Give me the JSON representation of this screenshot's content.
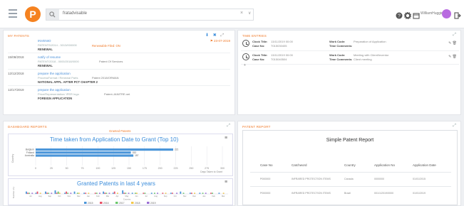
{
  "topbar": {
    "logo_letter": "P",
    "search_value": "fratadvisable",
    "clear_glyph": "×",
    "dropdown_glyph": "∨",
    "user_name": "WilliamHuggin",
    "icons": [
      "menu-icon",
      "search-icon",
      "help-icon",
      "settings-icon",
      "calendar-icon",
      "logout-icon"
    ]
  },
  "panel_patents": {
    "title": "MY PATENTS",
    "tools": [
      "⬇",
      "✖",
      "⤢"
    ],
    "rows": [
      {
        "date": "",
        "title": "INVENIO",
        "sub": "PATENTS/2014 - 3013/000000",
        "tag": "RENEWAL",
        "orange": "Renewable Filed: ON",
        "flag": "⚑ 23-07-2019"
      },
      {
        "date": "15/08/2018",
        "title": "notify of resume",
        "sub": "PATENT/2018 - 0000/2018/0000",
        "sub2": "Patent Of Services",
        "tag": "RENEWAL"
      },
      {
        "date": "12/12/2018",
        "title": "prepare the application",
        "sub": "ProcessFormat / Renewal Parts",
        "sub2": "Patent 2018/ORMAN",
        "tag": "NATIONAL APPL. AFTER PCT CHAPTER 2"
      },
      {
        "date": "12/17/2019",
        "title": "prepare the application",
        "sub": "Price/Representation/ IPER Ingo",
        "sub2": "Patent-JANITRE.net",
        "tag": "FOREIGN APPLICATION"
      }
    ]
  },
  "panel_tasks": {
    "title": "TIME ENTRIES",
    "cards": [
      {
        "clock_title_label": "Clock Title:",
        "clock_title": "13/11/2019 00:00",
        "case_label": "Case No:",
        "case": "T015030405",
        "work_code_label": "Work Code:",
        "work_code": "Preparation of Application",
        "comment_label": "Time Comments:",
        "comment": ""
      },
      {
        "clock_title_label": "Clock Title:",
        "clock_title": "13/11/2019 00:00",
        "case_label": "Case No:",
        "case": "T015040504",
        "work_code_label": "Work Code:",
        "work_code": "Meeting with Client/Inventor",
        "comment_label": "Time Comments:",
        "comment": "Client meeting"
      }
    ],
    "more": "+"
  },
  "panel_charts": {
    "title": "DASHBOARD REPORTS",
    "subhead": "Granted Patents",
    "chart1_title": "Time taken from Application Date to Grant (Top 10)",
    "chart2_title": "Granted Patents in last 4 years"
  },
  "panel_report": {
    "title": "PATENT REPORT",
    "report_title": "Simple Patent Report",
    "headers": [
      "Case No",
      "Catchword",
      "Country",
      "Application No",
      "Application Date"
    ],
    "rows": [
      [
        "P000000",
        "INFRARED PROTECTION ITEMS",
        "Canada",
        "0000000",
        "01/01/2015"
      ],
      [
        "P000000",
        "INFRARED PROTECTION ITEMS",
        "Brazil",
        "001/1/2019/0000",
        "01/01/2019"
      ]
    ]
  },
  "chart_data": [
    {
      "type": "bar",
      "title": "Time taken from Application Date to Grant (Top 10)",
      "orientation": "horizontal",
      "categories": [
        "Belgium",
        "Finland",
        "Australia"
      ],
      "values": [
        221,
        153,
        157
      ],
      "xlim": [
        0,
        300
      ],
      "xticks": [
        "0",
        "25",
        "50",
        "75",
        "100",
        "125",
        "150",
        "175",
        "200",
        "225",
        "250",
        "275",
        "300"
      ],
      "xlabel": "Days Taken to Grant",
      "ylabel": "Country",
      "colors": [
        "#4b96d9"
      ],
      "grid": true
    },
    {
      "type": "bar",
      "title": "Granted Patents in last 4 years",
      "categories": [
        "Jul",
        "Aug",
        "Sep",
        "Oct",
        "Nov",
        "Dec",
        "Jan",
        "Feb",
        "Mar",
        "Apr",
        "May",
        "Jun",
        "Jul",
        "Aug",
        "Sep",
        "Oct",
        "Nov",
        "Dec",
        "Jan",
        "Feb",
        "Mar"
      ],
      "ylabel": "Number of pats",
      "xlabel": "Country",
      "series": [
        {
          "name": "2015",
          "color": "#4b96d9",
          "values": [
            2,
            1,
            2,
            3,
            1,
            2,
            1,
            0,
            2,
            1,
            3,
            1,
            0,
            1,
            0,
            1,
            2,
            1,
            1,
            0,
            1
          ]
        },
        {
          "name": "2016",
          "color": "#e8556a",
          "values": [
            1,
            2,
            1,
            1,
            2,
            0,
            1,
            1,
            1,
            2,
            1,
            0,
            1,
            0,
            1,
            1,
            0,
            1,
            0,
            1,
            0
          ]
        },
        {
          "name": "2017",
          "color": "#6cc86c",
          "values": [
            1,
            0,
            1,
            2,
            1,
            1,
            0,
            1,
            1,
            0,
            1,
            1,
            1,
            1,
            0,
            0,
            1,
            0,
            1,
            1,
            0
          ]
        },
        {
          "name": "2018",
          "color": "#f3c84b",
          "values": [
            0,
            1,
            0,
            1,
            0,
            1,
            1,
            0,
            0,
            1,
            0,
            1,
            0,
            0,
            1,
            0,
            0,
            1,
            0,
            0,
            1
          ]
        },
        {
          "name": "2019",
          "color": "#9b6fd6",
          "values": [
            1,
            0,
            1,
            0,
            1,
            0,
            0,
            1,
            1,
            0,
            1,
            0,
            0,
            1,
            0,
            1,
            0,
            0,
            1,
            0,
            0
          ]
        }
      ],
      "legend": "bottom",
      "grid": false
    }
  ]
}
